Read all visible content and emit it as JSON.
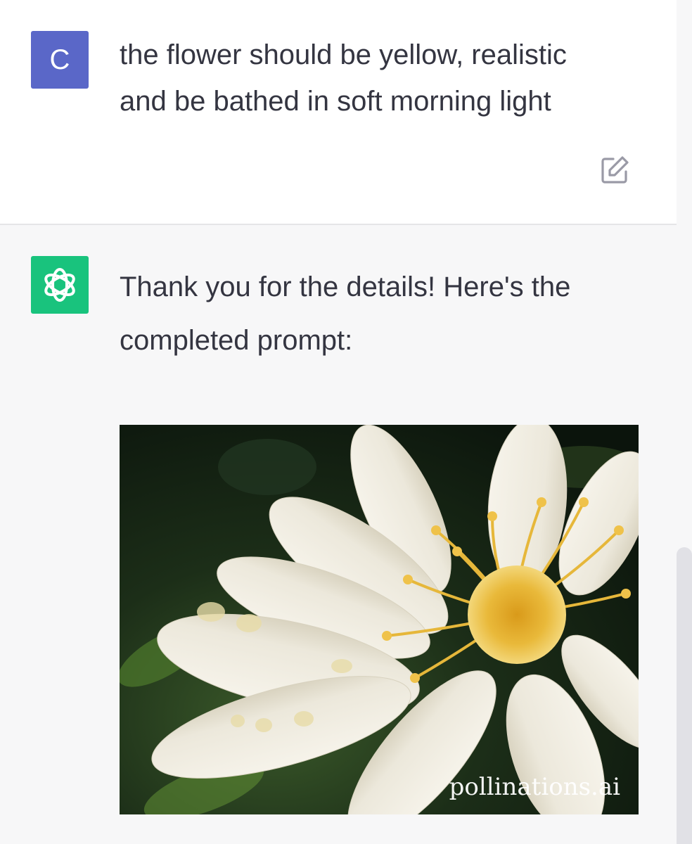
{
  "user_message": {
    "avatar_letter": "C",
    "text": "the flower should be yellow, realistic\nand be bathed in soft morning light",
    "edit_icon": "edit-icon"
  },
  "assistant_message": {
    "avatar_icon": "openai-logo-icon",
    "text": "Thank you for the details! Here's the\ncompleted prompt:",
    "image": {
      "subject": "white flower with yellow stamens",
      "watermark": "pollinations.ai"
    }
  },
  "colors": {
    "user_avatar": "#5a67c8",
    "assistant_avatar": "#19c37d",
    "assistant_bg": "#f7f7f8",
    "text": "#343541"
  }
}
